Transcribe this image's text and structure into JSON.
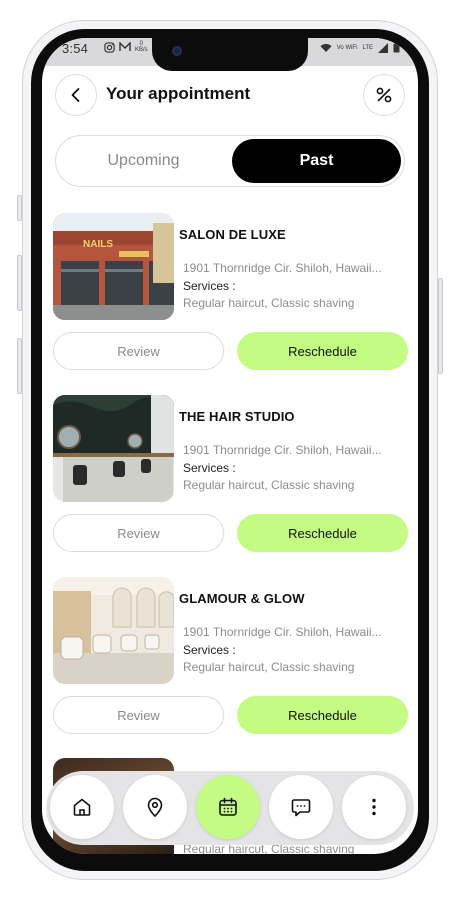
{
  "status_bar": {
    "time": "3:54",
    "left_icons": [
      "instagram-icon",
      "mail-icon"
    ],
    "kb_top": "0",
    "kb_bottom": "KB/s",
    "wifi_label": "Vo WiFi",
    "lte_label": "LTE"
  },
  "header": {
    "title": "Your appointment",
    "back_icon": "chevron-left-icon",
    "discount_icon": "discount-icon"
  },
  "tabs": {
    "upcoming": "Upcoming",
    "past": "Past",
    "active": "past"
  },
  "appointments": [
    {
      "name": "SALON DE LUXE",
      "address": "1901 Thornridge Cir. Shiloh, Hawaii...",
      "services_label": "Services :",
      "services": "Regular haircut, Classic shaving",
      "review": "Review",
      "reschedule": "Reschedule",
      "sign_text": "NAILS"
    },
    {
      "name": "THE HAIR STUDIO",
      "address": "1901 Thornridge Cir. Shiloh, Hawaii...",
      "services_label": "Services :",
      "services": "Regular haircut, Classic shaving",
      "review": "Review",
      "reschedule": "Reschedule"
    },
    {
      "name": "GLAMOUR & GLOW",
      "address": "1901 Thornridge Cir. Shiloh, Hawaii...",
      "services_label": "Services :",
      "services": "Regular haircut, Classic shaving",
      "review": "Review",
      "reschedule": "Reschedule"
    },
    {
      "services": "Regular haircut, Classic shaving"
    }
  ],
  "bottom_nav": [
    {
      "icon": "home-icon",
      "active": false
    },
    {
      "icon": "location-pin-icon",
      "active": false
    },
    {
      "icon": "calendar-icon",
      "active": true
    },
    {
      "icon": "chat-icon",
      "active": false
    },
    {
      "icon": "more-vertical-icon",
      "active": false
    }
  ],
  "colors": {
    "accent": "#c4fb83",
    "active_tab": "#000000",
    "muted_text": "#8d8d8d"
  }
}
